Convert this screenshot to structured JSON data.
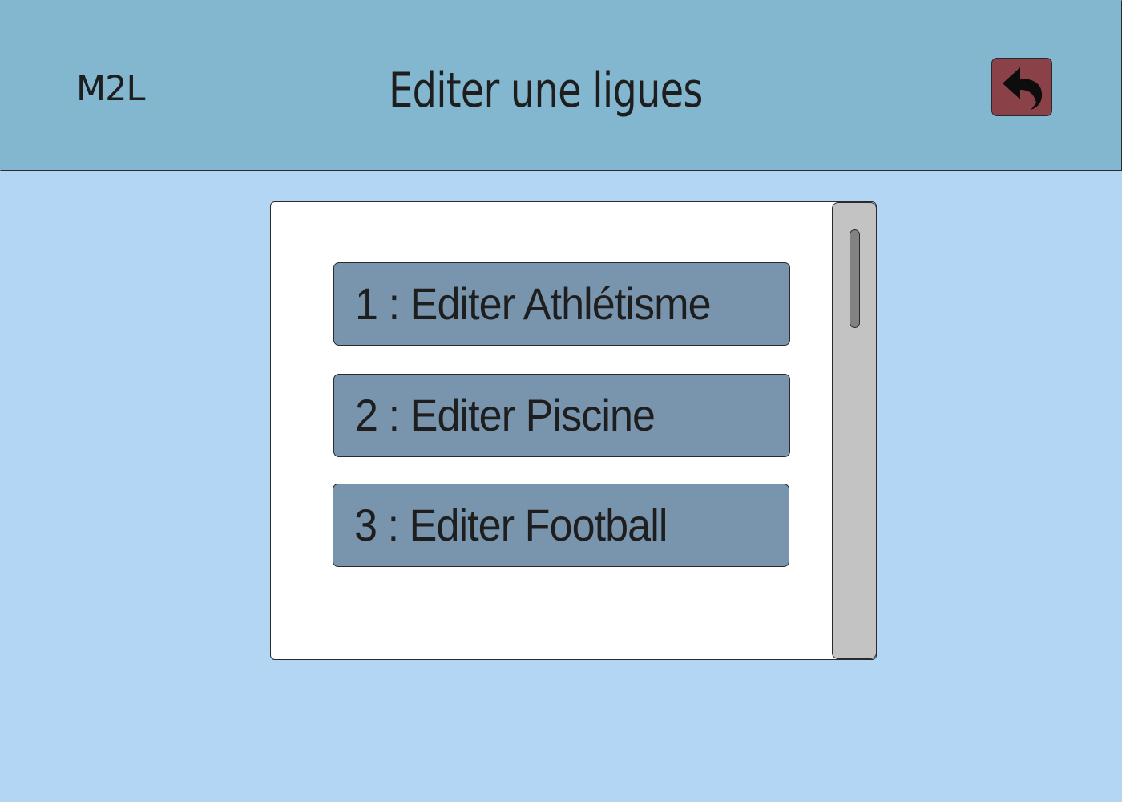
{
  "header": {
    "brand": "M2L",
    "title": "Editer une ligues",
    "back_icon": "undo-arrow-icon"
  },
  "leagues": {
    "items": [
      {
        "label": "1 : Editer Athlétisme"
      },
      {
        "label": "2 : Editer Piscine"
      },
      {
        "label": "3 : Editer Football"
      }
    ]
  },
  "colors": {
    "page_background": "#b3d6f5",
    "header_background": "#83b7cf",
    "back_button": "#8b4148",
    "item_background": "#7995ae",
    "scrollbar_track": "#c3c3c3",
    "scrollbar_thumb": "#828282"
  }
}
